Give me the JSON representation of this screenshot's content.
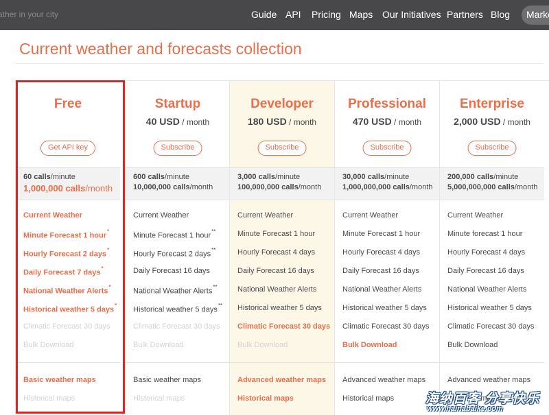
{
  "search": {
    "hint": "ather in your city"
  },
  "nav": {
    "items": [
      "Guide",
      "API",
      "Pricing",
      "Maps",
      "Our Initiatives",
      "Partners",
      "Blog"
    ],
    "market": "Marke"
  },
  "page": {
    "title": "Current weather and forecasts collection"
  },
  "colors": {
    "accent": "#eb6e4b",
    "highlight": "#e02424",
    "developer_bg": "#fcf7e6",
    "nav_bg": "#48484a"
  },
  "plans": [
    {
      "name": "Free",
      "price": "",
      "per": "",
      "cta": "Get API key",
      "calls_min_num": "60 calls",
      "calls_min_unit": "/minute",
      "calls_month_num": "1,000,000 calls",
      "calls_month_unit": "/month",
      "features": [
        {
          "label": "Current Weather",
          "state": "hl",
          "mark": ""
        },
        {
          "label": "Minute Forecast 1 hour",
          "state": "hl",
          "mark": "*"
        },
        {
          "label": "Hourly Forecast 2 days",
          "state": "hl",
          "mark": "*"
        },
        {
          "label": "Daily Forecast 7 days",
          "state": "hl",
          "mark": "*"
        },
        {
          "label": "National Weather Alerts",
          "state": "hl",
          "mark": "*"
        },
        {
          "label": "Historical weather 5 days",
          "state": "hl",
          "mark": "*"
        },
        {
          "label": "Climatic Forecast 30 days",
          "state": "dim",
          "mark": ""
        },
        {
          "label": "Bulk Download",
          "state": "dim",
          "mark": ""
        }
      ],
      "maps": [
        {
          "label": "Basic weather maps",
          "state": "hl"
        },
        {
          "label": "Historical maps",
          "state": "dim"
        }
      ]
    },
    {
      "name": "Startup",
      "price": "40 USD",
      "per": " / month",
      "cta": "Subscribe",
      "calls_min_num": "600 calls",
      "calls_min_unit": "/minute",
      "calls_month_num": "10,000,000 calls",
      "calls_month_unit": "/month",
      "features": [
        {
          "label": "Current Weather",
          "state": "",
          "mark": ""
        },
        {
          "label": "Minute Forecast 1 hour",
          "state": "",
          "mark": "**"
        },
        {
          "label": "Hourly Forecast 2 days",
          "state": "",
          "mark": "**"
        },
        {
          "label": "Daily Forecast 16 days",
          "state": "",
          "mark": ""
        },
        {
          "label": "National Weather Alerts",
          "state": "",
          "mark": "**"
        },
        {
          "label": "Historical weather 5 days",
          "state": "",
          "mark": "**"
        },
        {
          "label": "Climatic Forecast 30 days",
          "state": "dim",
          "mark": ""
        },
        {
          "label": "Bulk Download",
          "state": "dim",
          "mark": ""
        }
      ],
      "maps": [
        {
          "label": "Basic weather maps",
          "state": ""
        },
        {
          "label": "Historical maps",
          "state": "dim"
        }
      ]
    },
    {
      "name": "Developer",
      "price": "180 USD",
      "per": " / month",
      "cta": "Subscribe",
      "calls_min_num": "3,000 calls",
      "calls_min_unit": "/minute",
      "calls_month_num": "100,000,000 calls",
      "calls_month_unit": "/month",
      "features": [
        {
          "label": "Current Weather",
          "state": "",
          "mark": ""
        },
        {
          "label": "Minute Forecast 1 hour",
          "state": "",
          "mark": ""
        },
        {
          "label": "Hourly Forecast 4 days",
          "state": "",
          "mark": ""
        },
        {
          "label": "Daily Forecast 16 days",
          "state": "",
          "mark": ""
        },
        {
          "label": "National Weather Alerts",
          "state": "",
          "mark": ""
        },
        {
          "label": "Historical weather 5 days",
          "state": "",
          "mark": ""
        },
        {
          "label": "Climatic Forecast 30 days",
          "state": "hl",
          "mark": ""
        },
        {
          "label": "Bulk Download",
          "state": "dim",
          "mark": ""
        }
      ],
      "maps": [
        {
          "label": "Advanced weather maps",
          "state": "hl"
        },
        {
          "label": "Historical maps",
          "state": "hl"
        }
      ]
    },
    {
      "name": "Professional",
      "price": "470 USD",
      "per": " / month",
      "cta": "Subscribe",
      "calls_min_num": "30,000 calls",
      "calls_min_unit": "/minute",
      "calls_month_num": "1,000,000,000 calls",
      "calls_month_unit": "/month",
      "features": [
        {
          "label": "Current Weather",
          "state": "",
          "mark": ""
        },
        {
          "label": "Minute Forecast 1 hour",
          "state": "",
          "mark": ""
        },
        {
          "label": "Hourly Forecast 4 days",
          "state": "",
          "mark": ""
        },
        {
          "label": "Daily Forecast 16 days",
          "state": "",
          "mark": ""
        },
        {
          "label": "National Weather Alerts",
          "state": "",
          "mark": ""
        },
        {
          "label": "Historical weather 5 days",
          "state": "",
          "mark": ""
        },
        {
          "label": "Climatic Forecast 30 days",
          "state": "",
          "mark": ""
        },
        {
          "label": "Bulk Download",
          "state": "hl",
          "mark": ""
        }
      ],
      "maps": [
        {
          "label": "Advanced weather maps",
          "state": ""
        },
        {
          "label": "Historical maps",
          "state": ""
        }
      ]
    },
    {
      "name": "Enterprise",
      "price": "2,000 USD",
      "per": " / month",
      "cta": "Subscribe",
      "calls_min_num": "200,000 calls",
      "calls_min_unit": "/minute",
      "calls_month_num": "5,000,000,000 calls",
      "calls_month_unit": "/month",
      "features": [
        {
          "label": "Current Weather",
          "state": "",
          "mark": ""
        },
        {
          "label": "Minute forecast 1 hour",
          "state": "",
          "mark": ""
        },
        {
          "label": "Hourly Forecast 4 days",
          "state": "",
          "mark": ""
        },
        {
          "label": "Daily Forecast 16 days",
          "state": "",
          "mark": ""
        },
        {
          "label": "National Weather Alerts",
          "state": "",
          "mark": ""
        },
        {
          "label": "Historical weather 5 days",
          "state": "",
          "mark": ""
        },
        {
          "label": "Climatic Forecast 30 days",
          "state": "",
          "mark": ""
        },
        {
          "label": "Bulk Download",
          "state": "",
          "mark": ""
        }
      ],
      "maps": [
        {
          "label": "Advanced weather maps",
          "state": ""
        },
        {
          "label": "Historical maps",
          "state": ""
        }
      ]
    }
  ],
  "watermark": {
    "text": "海纳百客 分享快乐",
    "url": "www.hainabaike.com"
  }
}
